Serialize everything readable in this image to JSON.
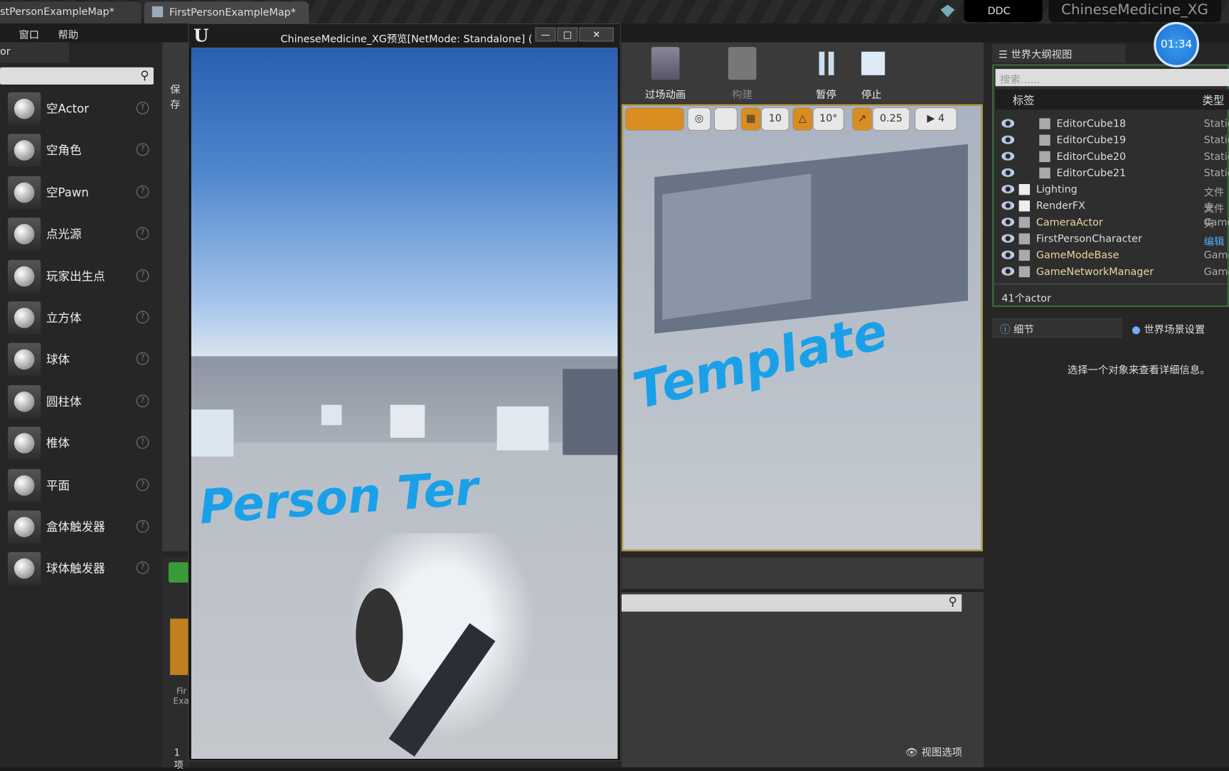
{
  "tabs": [
    {
      "label": "stPersonExampleMap*"
    },
    {
      "label": "FirstPersonExampleMap*"
    }
  ],
  "top_right": {
    "ddc": "DDC",
    "project": "ChineseMedicine_XG",
    "timer": "01:34"
  },
  "menu": {
    "window": "窗口",
    "help": "帮助"
  },
  "left_panel": {
    "tab": "or",
    "save_partial": "保存",
    "items": [
      {
        "label": "空Actor"
      },
      {
        "label": "空角色"
      },
      {
        "label": "空Pawn"
      },
      {
        "label": "点光源"
      },
      {
        "label": "玩家出生点"
      },
      {
        "label": "立方体"
      },
      {
        "label": "球体"
      },
      {
        "label": "圆柱体"
      },
      {
        "label": "椎体"
      },
      {
        "label": "平面"
      },
      {
        "label": "盒体触发器"
      },
      {
        "label": "球体触发器"
      }
    ]
  },
  "game_window": {
    "title": "ChineseMedicine_XG预览[NetMode: Standalone]  (",
    "floor_text": "Person Ter"
  },
  "toolbar": {
    "cinematics": "过场动画",
    "build": "构建",
    "pause": "暂停",
    "stop": "停止"
  },
  "viewport": {
    "grid": "10",
    "rotate": "10°",
    "scale": "0.25",
    "camera_speed": "4",
    "floor_text": "Template"
  },
  "outliner": {
    "title": "世界大纲视图",
    "search_placeholder": "搜索......",
    "col_label": "标签",
    "col_type": "类型",
    "rows": [
      {
        "name": "EditorCube18",
        "type": "Static"
      },
      {
        "name": "EditorCube19",
        "type": "Static"
      },
      {
        "name": "EditorCube20",
        "type": "Static"
      },
      {
        "name": "EditorCube21",
        "type": "Static"
      },
      {
        "name": "Lighting",
        "type": "文件夹"
      },
      {
        "name": "RenderFX",
        "type": "文件夹"
      },
      {
        "name": "CameraActor",
        "type": "Camer"
      },
      {
        "name": "FirstPersonCharacter",
        "type": "编辑"
      },
      {
        "name": "GameModeBase",
        "type": "Gamel"
      },
      {
        "name": "GameNetworkManager",
        "type": "Gamel"
      }
    ],
    "count": "41个actor"
  },
  "details": {
    "tab": "细节",
    "world_settings": "世界场景设置",
    "empty_msg": "选择一个对象来查看详细信息。"
  },
  "content_browser": {
    "item_count": "1项",
    "asset_label_1": "Fir",
    "asset_label_2": "Exa",
    "view_options": "视图选项"
  }
}
